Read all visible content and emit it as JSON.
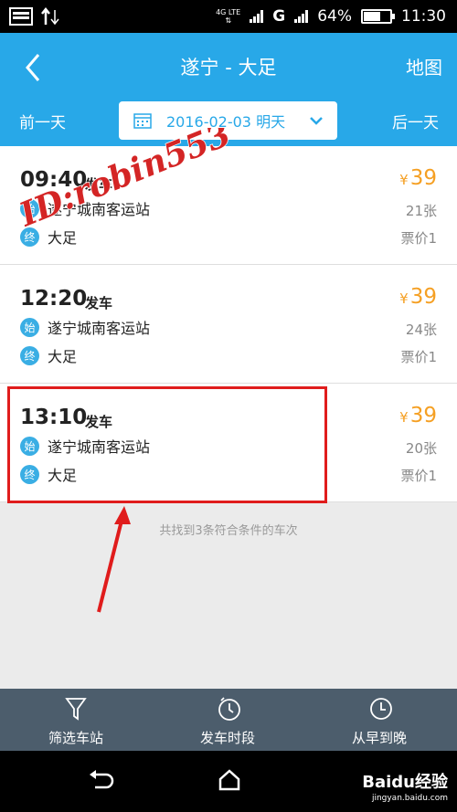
{
  "status_bar": {
    "network": "4G LTE",
    "carrier_g": "G",
    "battery": "64%",
    "battery_level": 0.64,
    "time": "11:30"
  },
  "header": {
    "title": "遂宁 - 大足",
    "map_label": "地图"
  },
  "date_bar": {
    "prev_label": "前一天",
    "date_text": "2016-02-03 明天",
    "next_label": "后一天"
  },
  "trips": [
    {
      "time": "09:40",
      "depart_label": "发车",
      "start_badge": "始",
      "start": "遂宁城南客运站",
      "end_badge": "终",
      "end": "大足",
      "price_symbol": "¥",
      "price": "39",
      "seats": "21张",
      "fare_label": "票价1"
    },
    {
      "time": "12:20",
      "depart_label": "发车",
      "start_badge": "始",
      "start": "遂宁城南客运站",
      "end_badge": "终",
      "end": "大足",
      "price_symbol": "¥",
      "price": "39",
      "seats": "24张",
      "fare_label": "票价1"
    },
    {
      "time": "13:10",
      "depart_label": "发车",
      "start_badge": "始",
      "start": "遂宁城南客运站",
      "end_badge": "终",
      "end": "大足",
      "price_symbol": "¥",
      "price": "39",
      "seats": "20张",
      "fare_label": "票价1"
    }
  ],
  "summary": "共找到3条符合条件的车次",
  "bottom_tabs": [
    {
      "label": "筛选车站",
      "icon": "filter-icon"
    },
    {
      "label": "发车时段",
      "icon": "clock-icon"
    },
    {
      "label": "从早到晚",
      "icon": "clock-sort-icon"
    }
  ],
  "watermark": "ID:robin553",
  "baidu": {
    "logo_text": "Baidu经验",
    "url": "jingyan.baidu.com"
  },
  "colors": {
    "primary": "#28a8e8",
    "price": "#f5a024",
    "highlight": "#e01c1c",
    "tabbar": "#4c5d6c"
  }
}
